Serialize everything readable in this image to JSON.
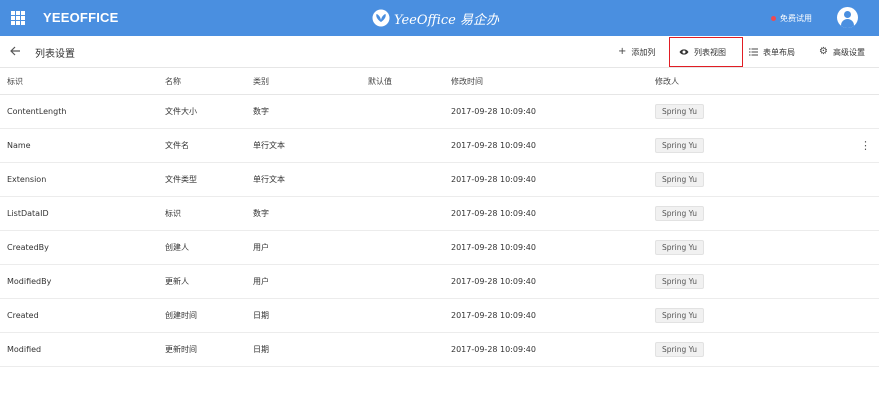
{
  "header": {
    "brand": "YEEOFFICE",
    "center_logo": "YeeOffice 易企办",
    "trial_label": "免费试用",
    "colors": {
      "bar": "#4a8fe0",
      "trial_dot": "#f0494f"
    }
  },
  "toolbar": {
    "title": "列表设置",
    "buttons": [
      {
        "icon": "plus-icon",
        "label": "添加列"
      },
      {
        "icon": "eye-icon",
        "label": "列表视图"
      },
      {
        "icon": "list-icon",
        "label": "表单布局"
      },
      {
        "icon": "gear-icon",
        "label": "高级设置"
      }
    ],
    "highlight_color": "#e11d24"
  },
  "table": {
    "columns": [
      "标识",
      "名称",
      "类别",
      "默认值",
      "修改时间",
      "修改人"
    ],
    "rows": [
      {
        "id": "ContentLength",
        "name": "文件大小",
        "type": "数字",
        "default": "",
        "modified": "2017-09-28 10:09:40",
        "modifier": "Spring Yu"
      },
      {
        "id": "Name",
        "name": "文件名",
        "type": "单行文本",
        "default": "",
        "modified": "2017-09-28 10:09:40",
        "modifier": "Spring Yu"
      },
      {
        "id": "Extension",
        "name": "文件类型",
        "type": "单行文本",
        "default": "",
        "modified": "2017-09-28 10:09:40",
        "modifier": "Spring Yu"
      },
      {
        "id": "ListDataID",
        "name": "标识",
        "type": "数字",
        "default": "",
        "modified": "2017-09-28 10:09:40",
        "modifier": "Spring Yu"
      },
      {
        "id": "CreatedBy",
        "name": "创建人",
        "type": "用户",
        "default": "",
        "modified": "2017-09-28 10:09:40",
        "modifier": "Spring Yu"
      },
      {
        "id": "ModifiedBy",
        "name": "更新人",
        "type": "用户",
        "default": "",
        "modified": "2017-09-28 10:09:40",
        "modifier": "Spring Yu"
      },
      {
        "id": "Created",
        "name": "创建时间",
        "type": "日期",
        "default": "",
        "modified": "2017-09-28 10:09:40",
        "modifier": "Spring Yu"
      },
      {
        "id": "Modified",
        "name": "更新时间",
        "type": "日期",
        "default": "",
        "modified": "2017-09-28 10:09:40",
        "modifier": "Spring Yu"
      }
    ],
    "row_menu_icon": "more-vertical-icon"
  }
}
